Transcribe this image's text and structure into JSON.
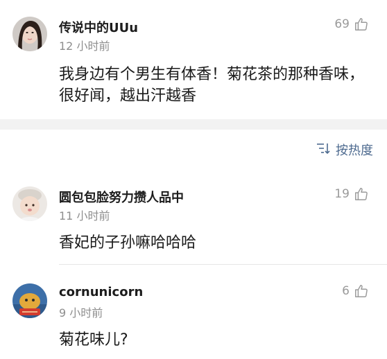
{
  "comments_top": {
    "user": "传说中的UUu",
    "time": "12 小时前",
    "likes": "69",
    "text": "我身边有个男生有体香！菊花茶的那种香味，很好闻，越出汗越香"
  },
  "sort": {
    "label": "按热度",
    "icon": "sort-icon"
  },
  "replies": [
    {
      "user": "圆包包脸努力攒人品中",
      "time": "11 小时前",
      "likes": "19",
      "text": "香妃的子孙嘛哈哈哈"
    },
    {
      "user": "cornunicorn",
      "time": "9 小时前",
      "likes": "6",
      "text": "菊花味儿?"
    }
  ],
  "colors": {
    "accent": "#4d6a8f",
    "muted": "#8e8e8e",
    "band": "#f2f2f2"
  }
}
